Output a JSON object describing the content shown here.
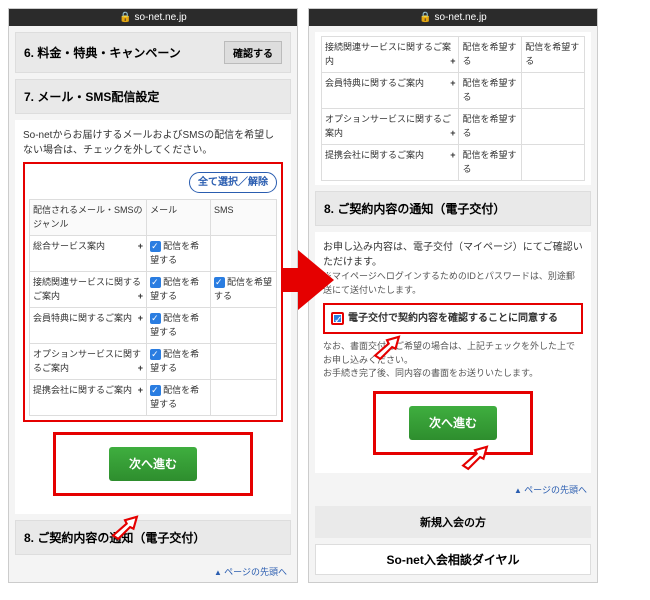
{
  "url": "so-net.ne.jp",
  "left": {
    "sec6": {
      "title": "6. 料金・特典・キャンペーン",
      "confirm": "確認する"
    },
    "sec7": {
      "title": "7. メール・SMS配信設定",
      "intro": "So-netからお届けするメールおよびSMSの配信を希望しない場合は、チェックを外してください。",
      "toggle_all": "全て選択／解除",
      "th_genre": "配信されるメール・SMSのジャンル",
      "th_mail": "メール",
      "th_sms": "SMS",
      "rows": [
        {
          "label": "総合サービス案内",
          "mail": "配信を希望する",
          "sms": ""
        },
        {
          "label": "接続関連サービスに関するご案内",
          "mail": "配信を希望する",
          "sms": "配信を希望する"
        },
        {
          "label": "会員特典に関するご案内",
          "mail": "配信を希望する",
          "sms": ""
        },
        {
          "label": "オプションサービスに関するご案内",
          "mail": "配信を希望する",
          "sms": ""
        },
        {
          "label": "提携会社に関するご案内",
          "mail": "配信を希望する",
          "sms": ""
        }
      ]
    },
    "next": "次へ進む",
    "sec8head": "8. ご契約内容の通知（電子交付）",
    "pagetop": "ページの先頭へ"
  },
  "right": {
    "rows": [
      {
        "label": "接続関連サービスに関するご案内",
        "mail": "配信を希望する",
        "sms": "配信を希望する"
      },
      {
        "label": "会員特典に関するご案内",
        "mail": "配信を希望する",
        "sms": ""
      },
      {
        "label": "オプションサービスに関するご案内",
        "mail": "配信を希望する",
        "sms": ""
      },
      {
        "label": "提携会社に関するご案内",
        "mail": "配信を希望する",
        "sms": ""
      }
    ],
    "sec8": {
      "title": "8. ご契約内容の通知（電子交付）",
      "line1": "お申し込み内容は、電子交付（マイページ）にてご確認いただけます。",
      "line2": "※マイページへログインするためのIDとパスワードは、別途郵送にて送付いたします。",
      "agree": "電子交付で契約内容を確認することに同意する",
      "line3": "なお、書面交付をご希望の場合は、上記チェックを外した上でお申し込みください。",
      "line4": "お手続き完了後、同内容の書面をお送りいたします。"
    },
    "next": "次へ進む",
    "pagetop": "ページの先頭へ",
    "newmember": "新規入会の方",
    "dial": "So-net入会相談ダイヤル"
  }
}
